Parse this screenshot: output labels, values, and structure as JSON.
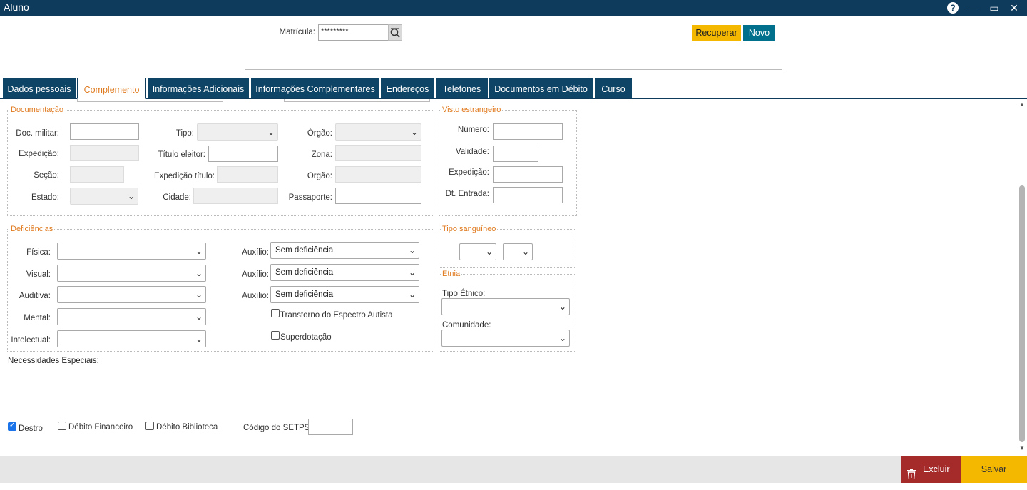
{
  "window": {
    "title": "Aluno",
    "help": "?",
    "minimize": "—",
    "maximize": "▭",
    "close": "✕"
  },
  "header": {
    "matricula_label": "Matrícula:",
    "matricula_value": "*********",
    "recuperar": "Recuperar",
    "novo": "Novo"
  },
  "tabs": [
    "Dados pessoais",
    "Complemento",
    "Informações Adicionais",
    "Informações Complementares",
    "Endereços",
    "Telefones",
    "Documentos em Débito",
    "Curso"
  ],
  "documentacao": {
    "legend": "Documentação",
    "doc_militar": "Doc. militar:",
    "expedicao": "Expedição:",
    "secao": "Seção:",
    "estado": "Estado:",
    "tipo": "Tipo:",
    "titulo_eleitor": "Título eleitor:",
    "expedicao_titulo": "Expedição título:",
    "cidade": "Cidade:",
    "orgao1": "Órgão:",
    "zona": "Zona:",
    "orgao2": "Orgão:",
    "passaporte": "Passaporte:"
  },
  "visto": {
    "legend": "Visto estrangeiro",
    "numero": "Número:",
    "validade": "Validade:",
    "expedicao": "Expedição:",
    "dt_entrada": "Dt. Entrada:"
  },
  "deficiencias": {
    "legend": "Deficiências",
    "fisica": "Física:",
    "visual": "Visual:",
    "auditiva": "Auditiva:",
    "mental": "Mental:",
    "intelectual": "Intelectual:",
    "auxilio": "Auxílio:",
    "auxilio_value": "Sem deficiência",
    "tea": "Transtorno do Espectro Autista",
    "superdotacao": "Superdotação"
  },
  "tipo_sanguineo": {
    "legend": "Tipo sanguíneo"
  },
  "etnia": {
    "legend": "Etnia",
    "tipo_etnico": "Tipo Étnico:",
    "comunidade": "Comunidade:"
  },
  "necessidades": "Necessidades Especiais:",
  "bottom": {
    "destro": "Destro",
    "debito_financeiro": "Débito Financeiro",
    "debito_biblioteca": "Débito Biblioteca",
    "codigo_setps": "Código do SETPS:"
  },
  "footer": {
    "excluir": "Excluir",
    "salvar": "Salvar"
  },
  "colors": {
    "navy": "#0e3a5c",
    "accent": "#e07a1f",
    "yellow": "#f5b800",
    "teal": "#00708c",
    "red": "#a52a2a"
  }
}
